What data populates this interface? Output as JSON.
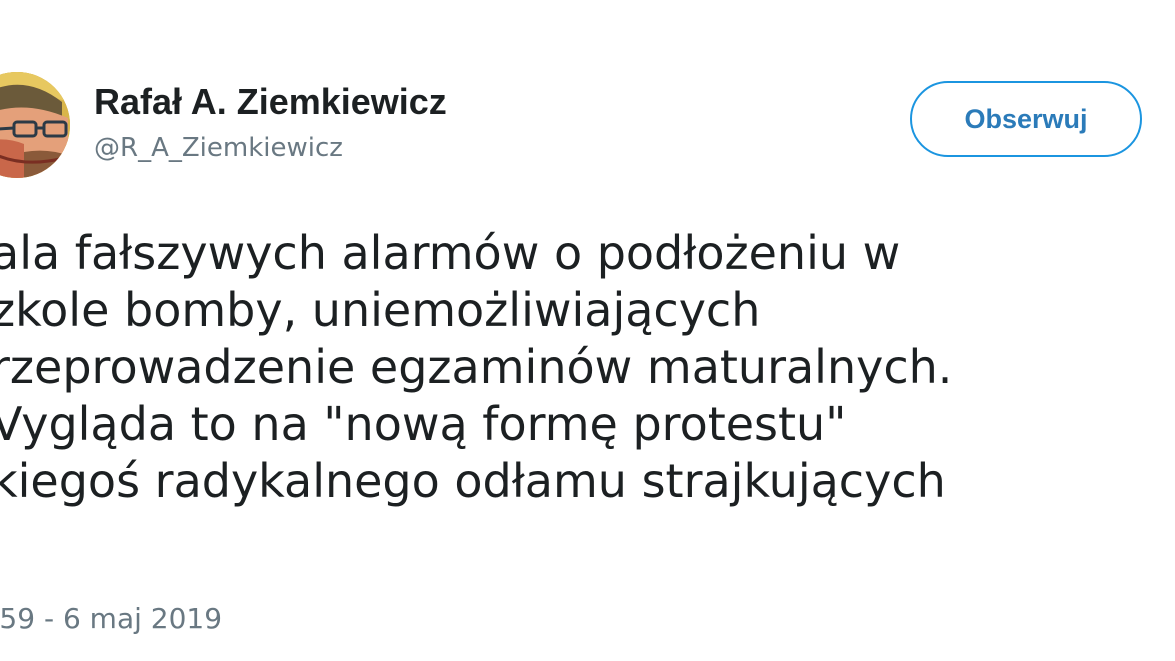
{
  "author": {
    "display_name": "Rafał A. Ziemkiewicz",
    "handle": "@R_A_Ziemkiewicz"
  },
  "follow_button": {
    "label": "Obserwuj"
  },
  "tweet": {
    "lines": [
      "ala fałszywych alarmów o podłożeniu w",
      "zkole bomby, uniemożliwiających",
      "rzeprowadzenie egzaminów maturalnych.",
      "Vygląda to na \"nową formę protestu\"",
      "kiegoś radykalnego odłamu strajkujących"
    ],
    "timestamp": ":59 - 6 maj 2019"
  },
  "colors": {
    "accent": "#1b95e0",
    "follow_text": "#2b7bb9",
    "text": "#1c2022",
    "secondary_text": "#697882",
    "background": "#ffffff"
  },
  "icons": {
    "avatar": "author-avatar-portrait"
  }
}
